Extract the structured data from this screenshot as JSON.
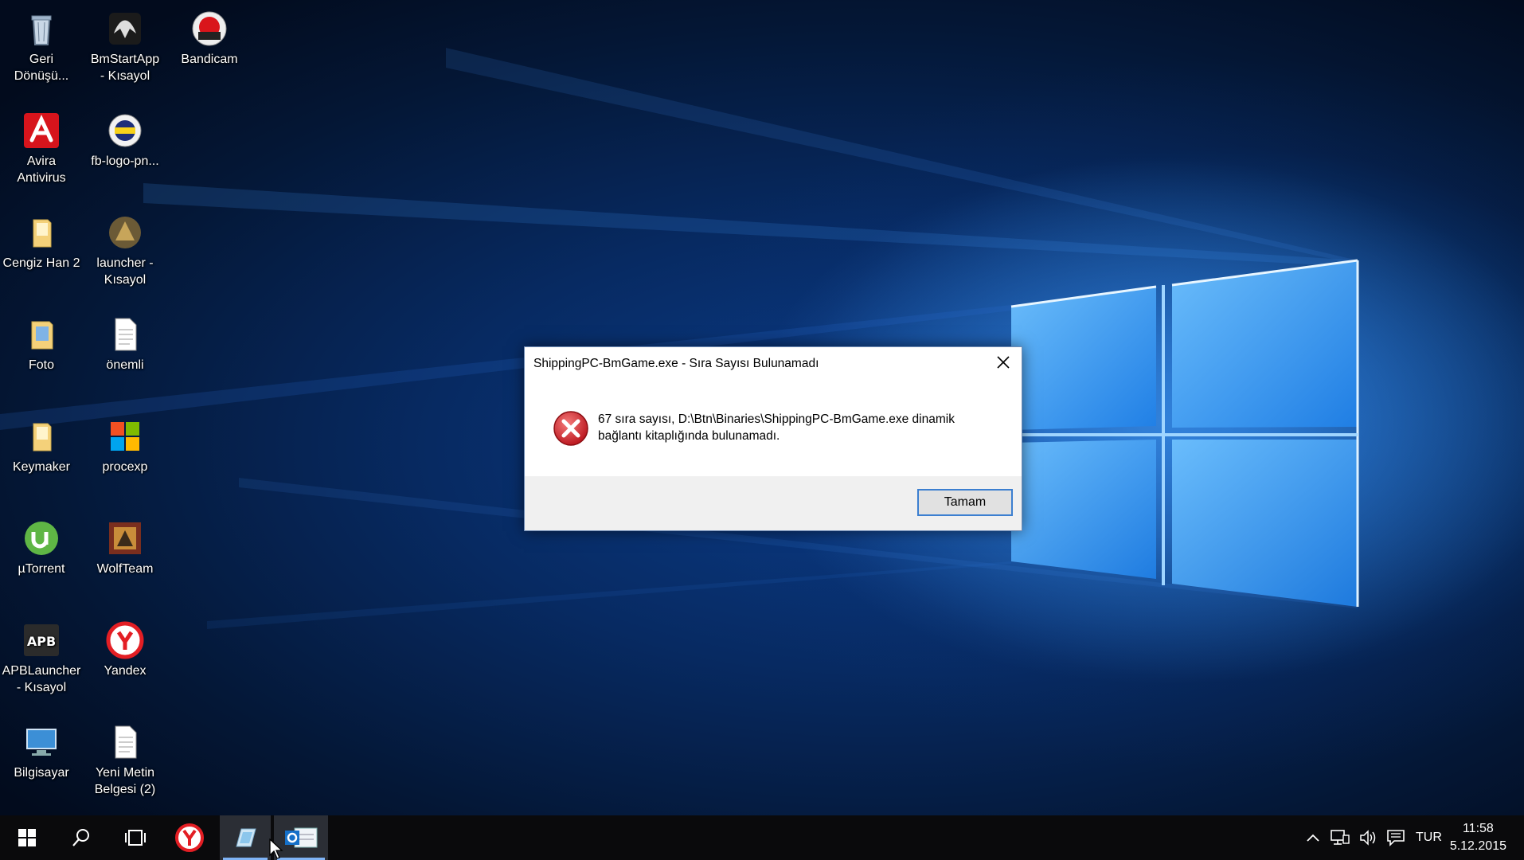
{
  "desktop": {
    "icons": [
      {
        "label": "Geri\nDönüşü...",
        "icon": "recycle-bin-icon"
      },
      {
        "label": "BmStartApp\n- Kısayol",
        "icon": "bmstartapp-icon"
      },
      {
        "label": "Bandicam",
        "icon": "bandicam-icon"
      },
      {
        "label": "Avira\nAntivirus",
        "icon": "avira-icon"
      },
      {
        "label": "fb-logo-pn...",
        "icon": "fb-logo-icon"
      },
      {
        "label": "Cengiz Han 2",
        "icon": "folder-icon"
      },
      {
        "label": "launcher -\nKısayol",
        "icon": "launcher-icon"
      },
      {
        "label": "Foto",
        "icon": "folder-icon"
      },
      {
        "label": "önemli",
        "icon": "text-file-icon"
      },
      {
        "label": "Keymaker",
        "icon": "folder-icon"
      },
      {
        "label": "procexp",
        "icon": "procexp-icon"
      },
      {
        "label": "µTorrent",
        "icon": "utorrent-icon"
      },
      {
        "label": "WolfTeam",
        "icon": "wolfteam-icon"
      },
      {
        "label": "APBLauncher\n- Kısayol",
        "icon": "apb-icon"
      },
      {
        "label": "Yandex",
        "icon": "yandex-icon"
      },
      {
        "label": "Bilgisayar",
        "icon": "computer-icon"
      },
      {
        "label": "Yeni Metin\nBelgesi (2)",
        "icon": "text-file-icon"
      }
    ]
  },
  "dialog": {
    "title": "ShippingPC-BmGame.exe - Sıra Sayısı Bulunamadı",
    "message_line1": "67 sıra sayısı, D:\\Btn\\Binaries\\ShippingPC-BmGame.exe dinamik",
    "message_line2": "bağlantı kitaplığında bulunamadı.",
    "ok_label": "Tamam",
    "icon": "error-icon"
  },
  "taskbar": {
    "items": [
      "start-icon",
      "search-icon",
      "task-view-icon",
      "yandex-browser-icon",
      "app-icon",
      "outlook-icon"
    ],
    "language": "TUR",
    "time": "11:58",
    "date": "5.12.2015",
    "accent_color": "#7fb3f5"
  }
}
